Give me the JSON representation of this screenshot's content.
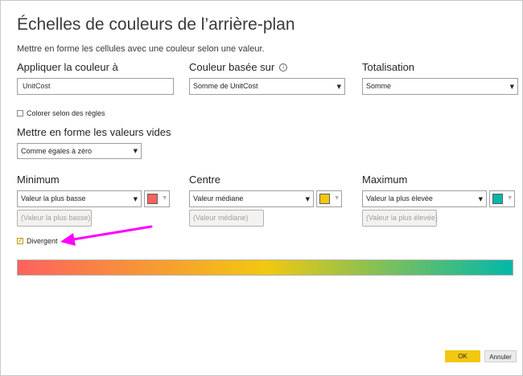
{
  "dialog": {
    "title": "Échelles de couleurs de l’arrière-plan",
    "subtitle": "Mettre en forme les cellules avec une couleur selon une valeur."
  },
  "apply_to": {
    "label": "Appliquer la couleur à",
    "value": "UnitCost"
  },
  "based_on": {
    "label": "Couleur basée sur",
    "value": "Somme de UnitCost",
    "info_icon": "info-circle-icon"
  },
  "summarization": {
    "label": "Totalisation",
    "value": "Somme"
  },
  "rules": {
    "label": "Colorer selon des règles",
    "checked": false
  },
  "empty_values": {
    "label": "Mettre en forme les valeurs vides",
    "value": "Comme égales à zéro"
  },
  "minimum": {
    "label": "Minimum",
    "value": "Valeur la plus basse",
    "color": "#FD625E",
    "placeholder": "(Valeur la plus basse)"
  },
  "center": {
    "label": "Centre",
    "value": "Valeur médiane",
    "color": "#F2C80F",
    "placeholder": "(Valeur médiane)"
  },
  "maximum": {
    "label": "Maximum",
    "value": "Valeur la plus élevée",
    "color": "#01B8AA",
    "placeholder": "(Valeur la plus élevée)"
  },
  "diverging": {
    "label": "Divergent",
    "checked": true
  },
  "annotation": {
    "arrow_color": "#FF00FF"
  },
  "footer": {
    "ok_label": "OK",
    "cancel_label": "Annuler",
    "ok_color": "#F2C811"
  }
}
